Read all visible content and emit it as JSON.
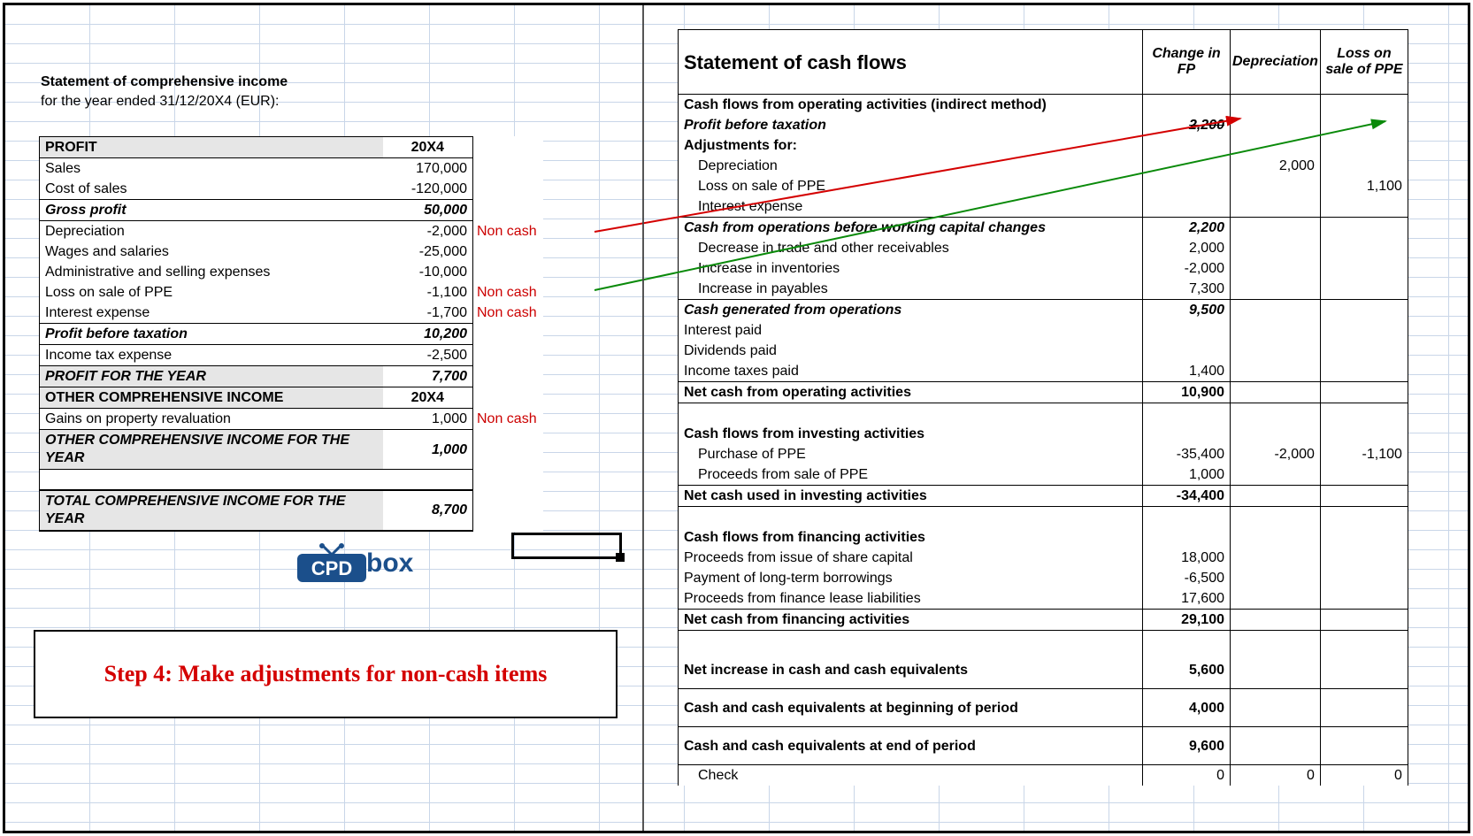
{
  "left": {
    "title": "Statement of comprehensive income",
    "subtitle": "for the year ended 31/12/20X4  (EUR):",
    "profit_header": "PROFIT",
    "year": "20X4",
    "rows": [
      {
        "label": "Sales",
        "value": "170,000"
      },
      {
        "label": "Cost of sales",
        "value": "-120,000"
      }
    ],
    "gross_profit": {
      "label": "Gross profit",
      "value": "50,000"
    },
    "expenses": [
      {
        "label": "Depreciation",
        "value": "-2,000",
        "note": "Non cash"
      },
      {
        "label": "Wages and salaries",
        "value": "-25,000",
        "note": ""
      },
      {
        "label": "Administrative and selling expenses",
        "value": "-10,000",
        "note": ""
      },
      {
        "label": "Loss on sale of PPE",
        "value": "-1,100",
        "note": "Non cash"
      },
      {
        "label": "Interest expense",
        "value": "-1,700",
        "note": "Non cash"
      }
    ],
    "pbt": {
      "label": "Profit before taxation",
      "value": "10,200"
    },
    "tax": {
      "label": "Income tax expense",
      "value": "-2,500"
    },
    "pfy": {
      "label": "PROFIT FOR THE YEAR",
      "value": "7,700"
    },
    "oci_header": {
      "label": "OTHER COMPREHENSIVE INCOME",
      "value": "20X4"
    },
    "oci_rows": [
      {
        "label": "Gains on property revaluation",
        "value": "1,000",
        "note": "Non cash"
      }
    ],
    "oci_total": {
      "label": "OTHER COMPREHENSIVE INCOME FOR THE YEAR",
      "value": "1,000"
    },
    "tci": {
      "label": "TOTAL COMPREHENSIVE INCOME FOR THE YEAR",
      "value": "8,700"
    }
  },
  "right": {
    "title": "Statement of cash flows",
    "cols": [
      "Change in FP",
      "Depreciation",
      "Loss on sale of PPE"
    ],
    "sections": {
      "op_header": "Cash flows from operating activities (indirect method)",
      "pbt": {
        "label": "Profit before taxation",
        "v1": "2,200"
      },
      "adj": "Adjustments for:",
      "adj_rows": [
        {
          "label": "Depreciation",
          "v2": "2,000"
        },
        {
          "label": "Loss on sale of PPE",
          "v3": "1,100"
        },
        {
          "label": "Interest expense"
        }
      ],
      "cash_before_wc": {
        "label": "Cash from operations before working capital changes",
        "v1": "2,200"
      },
      "wc_rows": [
        {
          "label": "Decrease in trade and other receivables",
          "v1": "2,000"
        },
        {
          "label": "Increase in inventories",
          "v1": "-2,000"
        },
        {
          "label": "Increase in payables",
          "v1": "7,300"
        }
      ],
      "cash_gen": {
        "label": "Cash generated from operations",
        "v1": "9,500"
      },
      "op_tail": [
        {
          "label": "Interest paid"
        },
        {
          "label": "Dividends paid"
        },
        {
          "label": "Income taxes paid",
          "v1": "1,400"
        }
      ],
      "net_op": {
        "label": "Net cash from operating activities",
        "v1": "10,900"
      },
      "inv_header": "Cash flows from investing activities",
      "inv_rows": [
        {
          "label": "Purchase of PPE",
          "v1": "-35,400",
          "v2": "-2,000",
          "v3": "-1,100"
        },
        {
          "label": "Proceeds from sale of PPE",
          "v1": "1,000"
        }
      ],
      "net_inv": {
        "label": "Net cash used in investing activities",
        "v1": "-34,400"
      },
      "fin_header": "Cash flows from financing activities",
      "fin_rows": [
        {
          "label": "Proceeds from issue of share capital",
          "v1": "18,000"
        },
        {
          "label": "Payment of long-term borrowings",
          "v1": "-6,500"
        },
        {
          "label": "Proceeds from finance lease liabilities",
          "v1": "17,600"
        }
      ],
      "net_fin": {
        "label": "Net cash from financing activities",
        "v1": "29,100"
      },
      "net_inc": {
        "label": "Net increase in cash and cash equivalents",
        "v1": "5,600"
      },
      "cash_beg": {
        "label": "Cash and cash equivalents at beginning of period",
        "v1": "4,000"
      },
      "cash_end": {
        "label": "Cash and cash equivalents at end of period",
        "v1": "9,600"
      },
      "check": {
        "label": "Check",
        "v1": "0",
        "v2": "0",
        "v3": "0"
      }
    }
  },
  "step": {
    "text": "Step 4: Make adjustments for non-cash items"
  },
  "logo": {
    "text": "box"
  }
}
